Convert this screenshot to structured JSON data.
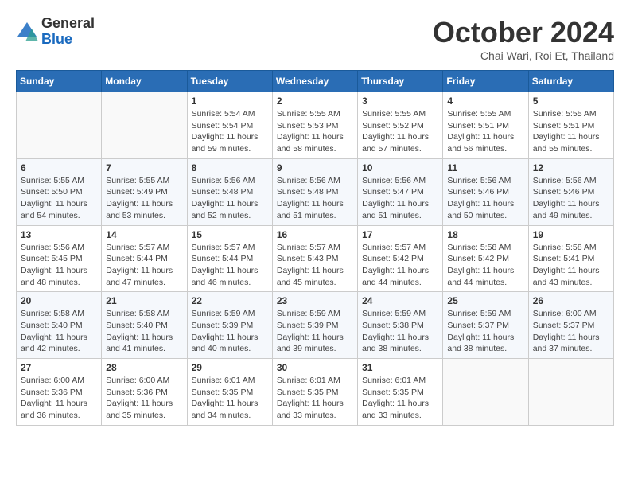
{
  "header": {
    "logo_general": "General",
    "logo_blue": "Blue",
    "month_title": "October 2024",
    "subtitle": "Chai Wari, Roi Et, Thailand"
  },
  "days_of_week": [
    "Sunday",
    "Monday",
    "Tuesday",
    "Wednesday",
    "Thursday",
    "Friday",
    "Saturday"
  ],
  "weeks": [
    [
      {
        "day": "",
        "info": ""
      },
      {
        "day": "",
        "info": ""
      },
      {
        "day": "1",
        "sunrise": "Sunrise: 5:54 AM",
        "sunset": "Sunset: 5:54 PM",
        "daylight": "Daylight: 11 hours and 59 minutes."
      },
      {
        "day": "2",
        "sunrise": "Sunrise: 5:55 AM",
        "sunset": "Sunset: 5:53 PM",
        "daylight": "Daylight: 11 hours and 58 minutes."
      },
      {
        "day": "3",
        "sunrise": "Sunrise: 5:55 AM",
        "sunset": "Sunset: 5:52 PM",
        "daylight": "Daylight: 11 hours and 57 minutes."
      },
      {
        "day": "4",
        "sunrise": "Sunrise: 5:55 AM",
        "sunset": "Sunset: 5:51 PM",
        "daylight": "Daylight: 11 hours and 56 minutes."
      },
      {
        "day": "5",
        "sunrise": "Sunrise: 5:55 AM",
        "sunset": "Sunset: 5:51 PM",
        "daylight": "Daylight: 11 hours and 55 minutes."
      }
    ],
    [
      {
        "day": "6",
        "sunrise": "Sunrise: 5:55 AM",
        "sunset": "Sunset: 5:50 PM",
        "daylight": "Daylight: 11 hours and 54 minutes."
      },
      {
        "day": "7",
        "sunrise": "Sunrise: 5:55 AM",
        "sunset": "Sunset: 5:49 PM",
        "daylight": "Daylight: 11 hours and 53 minutes."
      },
      {
        "day": "8",
        "sunrise": "Sunrise: 5:56 AM",
        "sunset": "Sunset: 5:48 PM",
        "daylight": "Daylight: 11 hours and 52 minutes."
      },
      {
        "day": "9",
        "sunrise": "Sunrise: 5:56 AM",
        "sunset": "Sunset: 5:48 PM",
        "daylight": "Daylight: 11 hours and 51 minutes."
      },
      {
        "day": "10",
        "sunrise": "Sunrise: 5:56 AM",
        "sunset": "Sunset: 5:47 PM",
        "daylight": "Daylight: 11 hours and 51 minutes."
      },
      {
        "day": "11",
        "sunrise": "Sunrise: 5:56 AM",
        "sunset": "Sunset: 5:46 PM",
        "daylight": "Daylight: 11 hours and 50 minutes."
      },
      {
        "day": "12",
        "sunrise": "Sunrise: 5:56 AM",
        "sunset": "Sunset: 5:46 PM",
        "daylight": "Daylight: 11 hours and 49 minutes."
      }
    ],
    [
      {
        "day": "13",
        "sunrise": "Sunrise: 5:56 AM",
        "sunset": "Sunset: 5:45 PM",
        "daylight": "Daylight: 11 hours and 48 minutes."
      },
      {
        "day": "14",
        "sunrise": "Sunrise: 5:57 AM",
        "sunset": "Sunset: 5:44 PM",
        "daylight": "Daylight: 11 hours and 47 minutes."
      },
      {
        "day": "15",
        "sunrise": "Sunrise: 5:57 AM",
        "sunset": "Sunset: 5:44 PM",
        "daylight": "Daylight: 11 hours and 46 minutes."
      },
      {
        "day": "16",
        "sunrise": "Sunrise: 5:57 AM",
        "sunset": "Sunset: 5:43 PM",
        "daylight": "Daylight: 11 hours and 45 minutes."
      },
      {
        "day": "17",
        "sunrise": "Sunrise: 5:57 AM",
        "sunset": "Sunset: 5:42 PM",
        "daylight": "Daylight: 11 hours and 44 minutes."
      },
      {
        "day": "18",
        "sunrise": "Sunrise: 5:58 AM",
        "sunset": "Sunset: 5:42 PM",
        "daylight": "Daylight: 11 hours and 44 minutes."
      },
      {
        "day": "19",
        "sunrise": "Sunrise: 5:58 AM",
        "sunset": "Sunset: 5:41 PM",
        "daylight": "Daylight: 11 hours and 43 minutes."
      }
    ],
    [
      {
        "day": "20",
        "sunrise": "Sunrise: 5:58 AM",
        "sunset": "Sunset: 5:40 PM",
        "daylight": "Daylight: 11 hours and 42 minutes."
      },
      {
        "day": "21",
        "sunrise": "Sunrise: 5:58 AM",
        "sunset": "Sunset: 5:40 PM",
        "daylight": "Daylight: 11 hours and 41 minutes."
      },
      {
        "day": "22",
        "sunrise": "Sunrise: 5:59 AM",
        "sunset": "Sunset: 5:39 PM",
        "daylight": "Daylight: 11 hours and 40 minutes."
      },
      {
        "day": "23",
        "sunrise": "Sunrise: 5:59 AM",
        "sunset": "Sunset: 5:39 PM",
        "daylight": "Daylight: 11 hours and 39 minutes."
      },
      {
        "day": "24",
        "sunrise": "Sunrise: 5:59 AM",
        "sunset": "Sunset: 5:38 PM",
        "daylight": "Daylight: 11 hours and 38 minutes."
      },
      {
        "day": "25",
        "sunrise": "Sunrise: 5:59 AM",
        "sunset": "Sunset: 5:37 PM",
        "daylight": "Daylight: 11 hours and 38 minutes."
      },
      {
        "day": "26",
        "sunrise": "Sunrise: 6:00 AM",
        "sunset": "Sunset: 5:37 PM",
        "daylight": "Daylight: 11 hours and 37 minutes."
      }
    ],
    [
      {
        "day": "27",
        "sunrise": "Sunrise: 6:00 AM",
        "sunset": "Sunset: 5:36 PM",
        "daylight": "Daylight: 11 hours and 36 minutes."
      },
      {
        "day": "28",
        "sunrise": "Sunrise: 6:00 AM",
        "sunset": "Sunset: 5:36 PM",
        "daylight": "Daylight: 11 hours and 35 minutes."
      },
      {
        "day": "29",
        "sunrise": "Sunrise: 6:01 AM",
        "sunset": "Sunset: 5:35 PM",
        "daylight": "Daylight: 11 hours and 34 minutes."
      },
      {
        "day": "30",
        "sunrise": "Sunrise: 6:01 AM",
        "sunset": "Sunset: 5:35 PM",
        "daylight": "Daylight: 11 hours and 33 minutes."
      },
      {
        "day": "31",
        "sunrise": "Sunrise: 6:01 AM",
        "sunset": "Sunset: 5:35 PM",
        "daylight": "Daylight: 11 hours and 33 minutes."
      },
      {
        "day": "",
        "info": ""
      },
      {
        "day": "",
        "info": ""
      }
    ]
  ]
}
